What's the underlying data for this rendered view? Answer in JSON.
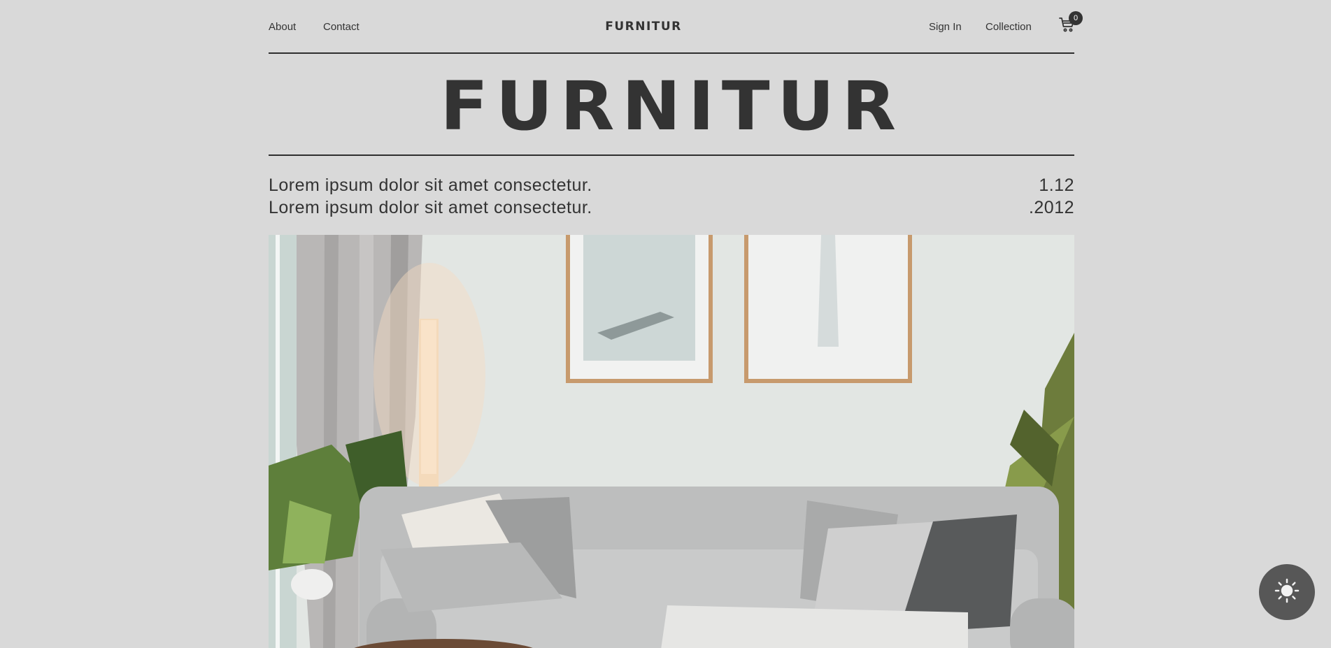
{
  "nav": {
    "about_label": "About",
    "contact_label": "Contact",
    "brand": "FURNITUR",
    "signin_label": "Sign In",
    "collection_label": "Collection",
    "cart_count": "0"
  },
  "hero": {
    "title": "FURNITUR"
  },
  "intro": {
    "line1": "Lorem ipsum dolor sit amet consectetur.",
    "line2": "Lorem ipsum dolor sit amet consectetur.",
    "date_part1": "1.12",
    "date_part2": ".2012"
  },
  "icons": {
    "cart": "cart-icon",
    "theme": "sun-icon"
  },
  "colors": {
    "background": "#d9d9d9",
    "text": "#333333",
    "toggle": "#575757"
  }
}
